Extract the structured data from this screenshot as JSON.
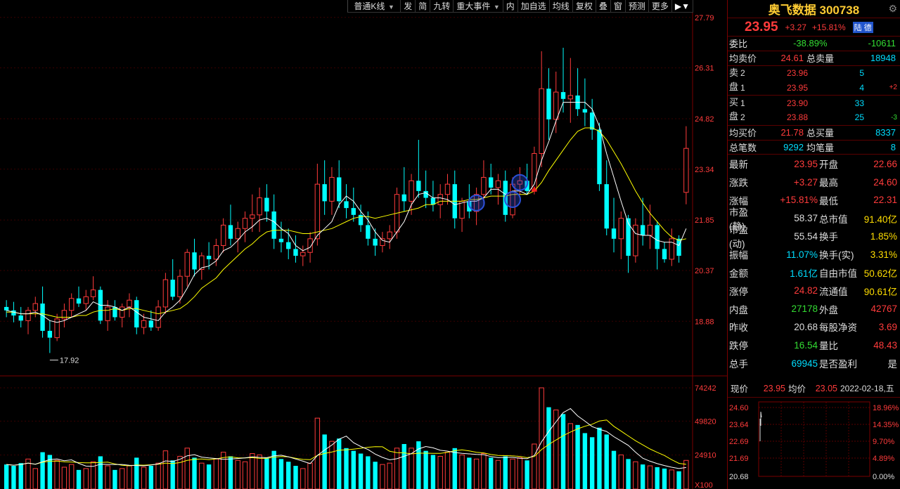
{
  "toolbar": {
    "items": [
      "普通K线",
      "发",
      "简",
      "九转",
      "重大事件",
      "内",
      "加自选",
      "均线",
      "复权",
      "叠",
      "窗",
      "预测",
      "更多"
    ]
  },
  "price_axis": [
    "27.79",
    "26.31",
    "24.82",
    "23.34",
    "21.85",
    "20.37",
    "18.88"
  ],
  "volume_axis": [
    "74242",
    "49820",
    "24910",
    "X100"
  ],
  "low_marker": "17.92",
  "chart_data": {
    "type": "candlestick",
    "ylim": [
      17.3,
      28.3
    ],
    "vol_max": 74242,
    "colors": {
      "up": "#ff3b3b",
      "down": "#00ffff",
      "ma5": "#ffffff",
      "ma10": "#ffff00",
      "grid": "#3a0000"
    },
    "candles": [
      [
        19.3,
        19.5,
        19.0,
        19.2,
        18000
      ],
      [
        19.2,
        19.45,
        18.85,
        19.05,
        17000
      ],
      [
        19.05,
        19.3,
        18.7,
        18.9,
        19000
      ],
      [
        18.9,
        19.3,
        18.5,
        19.2,
        22000
      ],
      [
        19.2,
        19.6,
        19.0,
        19.4,
        15000
      ],
      [
        19.4,
        19.9,
        18.4,
        18.6,
        27000
      ],
      [
        18.6,
        18.9,
        17.95,
        18.4,
        25000
      ],
      [
        18.4,
        19.1,
        18.3,
        18.95,
        21000
      ],
      [
        18.95,
        19.4,
        18.7,
        19.2,
        16000
      ],
      [
        19.2,
        19.7,
        19.0,
        19.55,
        18000
      ],
      [
        19.55,
        19.9,
        19.3,
        19.4,
        14000
      ],
      [
        19.4,
        19.8,
        19.2,
        19.6,
        15000
      ],
      [
        19.6,
        20.2,
        19.5,
        19.8,
        20000
      ],
      [
        19.8,
        19.9,
        18.8,
        18.9,
        24000
      ],
      [
        18.9,
        19.5,
        18.6,
        19.3,
        17000
      ],
      [
        19.3,
        19.5,
        18.9,
        19.0,
        14000
      ],
      [
        19.0,
        19.4,
        18.7,
        19.3,
        15000
      ],
      [
        19.3,
        19.7,
        19.0,
        19.5,
        17000
      ],
      [
        19.5,
        19.6,
        18.5,
        18.7,
        23000
      ],
      [
        18.7,
        19.1,
        18.5,
        18.9,
        16000
      ],
      [
        18.9,
        19.2,
        18.6,
        18.7,
        17000
      ],
      [
        18.7,
        19.5,
        18.6,
        19.3,
        19000
      ],
      [
        19.3,
        20.3,
        19.1,
        20.1,
        28000
      ],
      [
        20.1,
        20.7,
        19.5,
        19.6,
        21000
      ],
      [
        19.6,
        20.4,
        19.4,
        20.2,
        24000
      ],
      [
        20.2,
        21.0,
        19.9,
        20.9,
        30000
      ],
      [
        20.9,
        21.3,
        20.2,
        20.4,
        23000
      ],
      [
        20.4,
        20.9,
        20.1,
        20.8,
        19000
      ],
      [
        20.8,
        21.2,
        20.4,
        20.7,
        18000
      ],
      [
        20.7,
        21.3,
        20.5,
        21.1,
        22000
      ],
      [
        21.1,
        21.9,
        20.9,
        21.7,
        27000
      ],
      [
        21.7,
        22.3,
        21.1,
        21.3,
        24000
      ],
      [
        21.3,
        21.8,
        20.9,
        21.6,
        21000
      ],
      [
        21.6,
        22.1,
        21.2,
        21.9,
        20000
      ],
      [
        21.9,
        22.6,
        21.5,
        22.0,
        26000
      ],
      [
        22.0,
        22.8,
        21.5,
        22.5,
        25000
      ],
      [
        22.5,
        22.9,
        21.8,
        22.1,
        23000
      ],
      [
        22.1,
        22.6,
        21.0,
        21.3,
        28000
      ],
      [
        21.3,
        21.8,
        20.9,
        21.2,
        22000
      ],
      [
        21.2,
        21.6,
        20.7,
        21.0,
        20000
      ],
      [
        21.0,
        21.4,
        20.6,
        20.8,
        17000
      ],
      [
        20.8,
        21.1,
        20.5,
        20.9,
        15000
      ],
      [
        20.9,
        21.5,
        20.6,
        21.3,
        19000
      ],
      [
        21.3,
        23.5,
        21.1,
        22.9,
        52000
      ],
      [
        22.9,
        23.6,
        22.0,
        22.4,
        40000
      ],
      [
        22.4,
        23.4,
        22.0,
        23.1,
        35000
      ],
      [
        23.1,
        23.6,
        22.2,
        22.4,
        37000
      ],
      [
        22.4,
        22.9,
        21.9,
        22.2,
        30000
      ],
      [
        22.2,
        22.8,
        21.8,
        22.0,
        28000
      ],
      [
        22.0,
        22.3,
        21.5,
        21.7,
        26000
      ],
      [
        21.7,
        22.1,
        21.1,
        21.3,
        24000
      ],
      [
        21.3,
        21.6,
        20.8,
        21.1,
        20000
      ],
      [
        21.1,
        21.5,
        20.9,
        21.3,
        18000
      ],
      [
        21.3,
        21.7,
        21.0,
        21.5,
        19000
      ],
      [
        21.5,
        22.8,
        21.3,
        22.6,
        30000
      ],
      [
        22.6,
        23.4,
        22.1,
        22.4,
        33000
      ],
      [
        22.4,
        23.2,
        22.0,
        23.0,
        30000
      ],
      [
        23.0,
        24.2,
        22.5,
        22.7,
        35000
      ],
      [
        22.7,
        23.3,
        22.2,
        22.5,
        28000
      ],
      [
        22.5,
        23.0,
        22.1,
        22.3,
        25000
      ],
      [
        22.3,
        22.9,
        21.9,
        22.6,
        24000
      ],
      [
        22.6,
        23.2,
        22.3,
        22.9,
        27000
      ],
      [
        22.9,
        23.3,
        21.6,
        21.9,
        30000
      ],
      [
        21.9,
        22.5,
        21.5,
        22.4,
        25000
      ],
      [
        22.4,
        22.9,
        21.9,
        22.1,
        23000
      ],
      [
        22.1,
        22.8,
        21.7,
        22.6,
        22000
      ],
      [
        22.6,
        23.6,
        22.3,
        23.1,
        26000
      ],
      [
        23.1,
        23.5,
        22.6,
        22.8,
        23000
      ],
      [
        22.8,
        23.2,
        22.3,
        23.0,
        21000
      ],
      [
        23.0,
        23.3,
        21.8,
        22.0,
        24000
      ],
      [
        22.0,
        23.1,
        21.9,
        22.9,
        22000
      ],
      [
        22.9,
        23.4,
        22.6,
        23.0,
        23000
      ],
      [
        23.0,
        23.5,
        22.6,
        22.7,
        21000
      ],
      [
        22.7,
        24.0,
        22.6,
        23.8,
        33000
      ],
      [
        23.8,
        26.8,
        23.4,
        25.7,
        74242
      ],
      [
        25.7,
        26.3,
        24.2,
        24.8,
        60000
      ],
      [
        24.8,
        26.2,
        24.4,
        25.6,
        58000
      ],
      [
        25.6,
        26.9,
        25.0,
        25.4,
        55000
      ],
      [
        25.4,
        26.6,
        24.7,
        25.5,
        48000
      ],
      [
        25.5,
        26.3,
        24.9,
        25.1,
        47000
      ],
      [
        25.1,
        26.0,
        24.6,
        25.0,
        41000
      ],
      [
        25.0,
        25.4,
        24.2,
        24.5,
        38000
      ],
      [
        24.5,
        24.7,
        22.7,
        22.9,
        45000
      ],
      [
        22.9,
        23.6,
        21.4,
        21.6,
        40000
      ],
      [
        21.6,
        22.5,
        20.9,
        21.3,
        28000
      ],
      [
        21.3,
        22.1,
        20.7,
        21.9,
        25000
      ],
      [
        21.9,
        22.0,
        20.3,
        20.8,
        22000
      ],
      [
        20.8,
        21.9,
        20.6,
        21.7,
        20000
      ],
      [
        21.7,
        22.5,
        21.1,
        21.4,
        18000
      ],
      [
        21.4,
        22.3,
        21.0,
        21.7,
        17000
      ],
      [
        21.7,
        21.8,
        20.4,
        21.0,
        16000
      ],
      [
        21.0,
        21.2,
        20.6,
        20.7,
        15000
      ],
      [
        20.7,
        21.6,
        20.5,
        21.3,
        14000
      ],
      [
        21.3,
        21.4,
        20.6,
        20.8,
        13000
      ],
      [
        22.66,
        24.6,
        22.31,
        23.95,
        21000
      ]
    ],
    "ma5": [
      19.2,
      19.15,
      19.1,
      19.1,
      19.15,
      19.05,
      18.9,
      18.85,
      18.9,
      19.0,
      19.1,
      19.2,
      19.45,
      19.35,
      19.35,
      19.3,
      19.2,
      19.3,
      19.15,
      19.0,
      18.95,
      18.9,
      19.15,
      19.3,
      19.5,
      19.85,
      20.25,
      20.45,
      20.5,
      20.65,
      20.95,
      21.05,
      21.25,
      21.5,
      21.65,
      21.85,
      21.9,
      21.8,
      21.6,
      21.45,
      21.1,
      20.95,
      21.05,
      21.4,
      21.6,
      21.8,
      22.3,
      22.55,
      22.4,
      22.1,
      21.85,
      21.5,
      21.25,
      21.2,
      21.5,
      21.8,
      22.3,
      22.6,
      22.65,
      22.5,
      22.5,
      22.45,
      22.3,
      22.35,
      22.4,
      22.4,
      22.5,
      22.75,
      22.75,
      22.6,
      22.7,
      22.7,
      22.6,
      22.9,
      23.6,
      24.15,
      24.75,
      25.3,
      25.3,
      25.3,
      25.3,
      25.1,
      24.6,
      23.8,
      23.1,
      22.4,
      21.75,
      21.45,
      21.4,
      21.4,
      21.25,
      21.2,
      21.2,
      21.1,
      21.6
    ],
    "ma10": [
      19.15,
      19.15,
      19.1,
      19.1,
      19.1,
      19.1,
      19.05,
      19.0,
      19.0,
      19.0,
      19.05,
      19.05,
      19.15,
      19.2,
      19.2,
      19.25,
      19.2,
      19.25,
      19.25,
      19.2,
      19.15,
      19.1,
      19.15,
      19.2,
      19.25,
      19.4,
      19.6,
      19.85,
      20.0,
      20.15,
      20.4,
      20.6,
      20.8,
      21.0,
      21.15,
      21.35,
      21.5,
      21.55,
      21.55,
      21.55,
      21.5,
      21.45,
      21.45,
      21.5,
      21.55,
      21.6,
      21.7,
      21.8,
      21.9,
      21.95,
      21.95,
      21.9,
      21.95,
      22.0,
      22.05,
      22.1,
      22.15,
      22.2,
      22.3,
      22.3,
      22.4,
      22.4,
      22.4,
      22.4,
      22.45,
      22.45,
      22.5,
      22.55,
      22.55,
      22.55,
      22.6,
      22.6,
      22.6,
      22.7,
      22.95,
      23.3,
      23.6,
      23.9,
      24.2,
      24.45,
      24.55,
      24.55,
      24.45,
      24.2,
      23.85,
      23.5,
      23.1,
      22.7,
      22.35,
      22.05,
      21.8,
      21.55,
      21.35,
      21.25,
      21.3
    ]
  },
  "panel": {
    "title": "奥飞数据 300738",
    "last": "23.95",
    "change": "+3.27",
    "pct": "+15.81%",
    "badge": "陆 德",
    "webi": {
      "label": "委比",
      "pct": "-38.89%",
      "diff": "-10611"
    },
    "sell_avg": {
      "label": "均卖价",
      "val": "24.61",
      "label2": "总卖量",
      "val2": "18948"
    },
    "asks": [
      {
        "lvl": "2",
        "price": "23.96",
        "vol": "5",
        "delta": ""
      },
      {
        "lvl": "1",
        "price": "23.95",
        "vol": "4",
        "delta": "+2"
      }
    ],
    "bids": [
      {
        "lvl": "1",
        "price": "23.90",
        "vol": "33",
        "delta": ""
      },
      {
        "lvl": "2",
        "price": "23.88",
        "vol": "25",
        "delta": "-3"
      }
    ],
    "ask_side": "卖盘",
    "bid_side": "买盘",
    "buy_avg": {
      "label": "均买价",
      "val": "21.78",
      "label2": "总买量",
      "val2": "8337"
    },
    "trades": {
      "label": "总笔数",
      "val": "9292",
      "label2": "均笔量",
      "val2": "8"
    },
    "stats": [
      {
        "l1": "最新",
        "v1": "23.95",
        "c1": "red",
        "l2": "开盘",
        "v2": "22.66",
        "c2": "red"
      },
      {
        "l1": "涨跌",
        "v1": "+3.27",
        "c1": "red",
        "l2": "最高",
        "v2": "24.60",
        "c2": "red"
      },
      {
        "l1": "涨幅",
        "v1": "+15.81%",
        "c1": "red",
        "l2": "最低",
        "v2": "22.31",
        "c2": "red"
      },
      {
        "l1": "市盈(静)",
        "v1": "58.37",
        "c1": "white",
        "l2": "总市值",
        "v2": "91.40亿",
        "c2": "yellow"
      },
      {
        "l1": "市盈(动)",
        "v1": "55.54",
        "c1": "white",
        "l2": "换手",
        "v2": "1.85%",
        "c2": "yellow"
      },
      {
        "l1": "振幅",
        "v1": "11.07%",
        "c1": "cyan",
        "l2": "换手(实)",
        "v2": "3.31%",
        "c2": "yellow"
      },
      {
        "l1": "金额",
        "v1": "1.61亿",
        "c1": "cyan",
        "l2": "自由市值",
        "v2": "50.62亿",
        "c2": "yellow"
      },
      {
        "l1": "涨停",
        "v1": "24.82",
        "c1": "red",
        "l2": "流通值",
        "v2": "90.61亿",
        "c2": "yellow"
      },
      {
        "l1": "内盘",
        "v1": "27178",
        "c1": "green",
        "l2": "外盘",
        "v2": "42767",
        "c2": "red"
      },
      {
        "l1": "昨收",
        "v1": "20.68",
        "c1": "white",
        "l2": "每股净资",
        "v2": "3.69",
        "c2": "red"
      },
      {
        "l1": "跌停",
        "v1": "16.54",
        "c1": "green",
        "l2": "量比",
        "v2": "48.43",
        "c2": "red"
      },
      {
        "l1": "总手",
        "v1": "69945",
        "c1": "cyan",
        "l2": "是否盈利",
        "v2": "是",
        "c2": "white"
      }
    ],
    "mini": {
      "now_label": "现价",
      "now": "23.95",
      "avg_label": "均价",
      "avg": "23.05",
      "date": "2022-02-18,五",
      "left_axis": [
        "24.60",
        "23.64",
        "22.69",
        "21.69",
        "20.68"
      ],
      "right_axis": [
        "18.96%",
        "14.35%",
        "9.70%",
        "4.89%",
        "0.00%"
      ]
    }
  }
}
